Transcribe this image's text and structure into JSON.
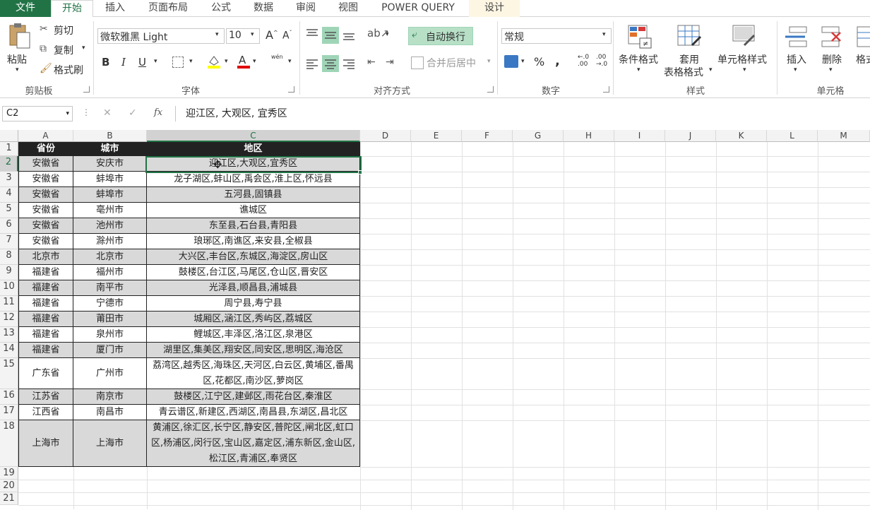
{
  "tabs": [
    "文件",
    "开始",
    "插入",
    "页面布局",
    "公式",
    "数据",
    "审阅",
    "视图",
    "POWER QUERY",
    "设计"
  ],
  "clipboard": {
    "paste": "粘贴",
    "cut": "剪切",
    "copy": "复制",
    "format_painter": "格式刷",
    "group": "剪贴板"
  },
  "font": {
    "name": "微软雅黑 Light",
    "size": "10",
    "bold": "B",
    "italic": "I",
    "underline": "U",
    "group": "字体",
    "phonetic": "wén"
  },
  "alignment": {
    "wrap": "自动换行",
    "merge": "合并后居中",
    "group": "对齐方式"
  },
  "number": {
    "format": "常规",
    "percent": "%",
    "comma": ",",
    "group": "数字"
  },
  "styles": {
    "conditional": "条件格式",
    "table_line1": "套用",
    "table_line2": "表格格式",
    "cell_styles": "单元格样式",
    "group": "样式"
  },
  "cells": {
    "insert": "插入",
    "delete": "删除",
    "format": "格式",
    "group": "单元格"
  },
  "formula_bar": {
    "name_box": "C2",
    "fx": "fx",
    "value": "迎江区, 大观区, 宜秀区"
  },
  "columns": [
    "A",
    "B",
    "C",
    "D",
    "E",
    "F",
    "G",
    "H",
    "I",
    "J",
    "K",
    "L",
    "M"
  ],
  "rows": [
    "1",
    "2",
    "3",
    "4",
    "5",
    "6",
    "7",
    "8",
    "9",
    "10",
    "11",
    "12",
    "13",
    "14",
    "15",
    "16",
    "17",
    "18",
    "19",
    "20",
    "21"
  ],
  "table": {
    "headers": [
      "省份",
      "城市",
      "地区"
    ],
    "data": [
      [
        "安徽省",
        "安庆市",
        "迎江区,大观区,宜秀区"
      ],
      [
        "安徽省",
        "蚌埠市",
        "龙子湖区,蚌山区,禹会区,淮上区,怀远县"
      ],
      [
        "安徽省",
        "蚌埠市",
        "五河县,固镇县"
      ],
      [
        "安徽省",
        "亳州市",
        "谯城区"
      ],
      [
        "安徽省",
        "池州市",
        "东至县,石台县,青阳县"
      ],
      [
        "安徽省",
        "滁州市",
        "琅琊区,南谯区,来安县,全椒县"
      ],
      [
        "北京市",
        "北京市",
        "大兴区,丰台区,东城区,海淀区,房山区"
      ],
      [
        "福建省",
        "福州市",
        "鼓楼区,台江区,马尾区,仓山区,晋安区"
      ],
      [
        "福建省",
        "南平市",
        "光泽县,顺昌县,浦城县"
      ],
      [
        "福建省",
        "宁德市",
        "周宁县,寿宁县"
      ],
      [
        "福建省",
        "莆田市",
        "城厢区,涵江区,秀屿区,荔城区"
      ],
      [
        "福建省",
        "泉州市",
        "鲤城区,丰泽区,洛江区,泉港区"
      ],
      [
        "福建省",
        "厦门市",
        "湖里区,集美区,翔安区,同安区,思明区,海沧区"
      ],
      [
        "广东省",
        "广州市",
        "荔湾区,越秀区,海珠区,天河区,白云区,黄埔区,番禺区,花都区,南沙区,萝岗区"
      ],
      [
        "江苏省",
        "南京市",
        "鼓楼区,江宁区,建邺区,雨花台区,秦淮区"
      ],
      [
        "江西省",
        "南昌市",
        "青云谱区,新建区,西湖区,南昌县,东湖区,昌北区"
      ],
      [
        "上海市",
        "上海市",
        "黄浦区,徐汇区,长宁区,静安区,普陀区,闸北区,虹口区,杨浦区,闵行区,宝山区,嘉定区,浦东新区,金山区,松江区,青浦区,奉贤区"
      ]
    ]
  },
  "colors": {
    "accent": "#217346",
    "header_bg": "#222222",
    "row_gray": "#d9d9d9",
    "selection": "#217346"
  }
}
